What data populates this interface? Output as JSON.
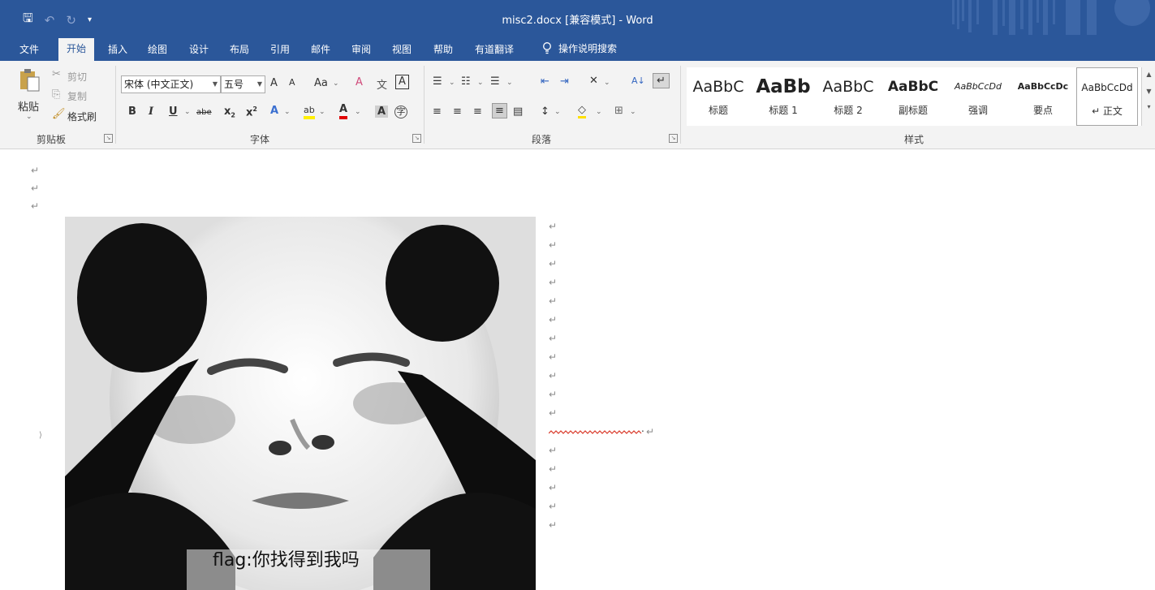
{
  "window": {
    "title": "misc2.docx [兼容模式] - Word"
  },
  "quick_access": {
    "save": "🖫",
    "undo": "↶",
    "redo": "↻",
    "customize": "▾"
  },
  "tabs": [
    {
      "label": "文件"
    },
    {
      "label": "开始"
    },
    {
      "label": "插入"
    },
    {
      "label": "绘图"
    },
    {
      "label": "设计"
    },
    {
      "label": "布局"
    },
    {
      "label": "引用"
    },
    {
      "label": "邮件"
    },
    {
      "label": "审阅"
    },
    {
      "label": "视图"
    },
    {
      "label": "帮助"
    },
    {
      "label": "有道翻译"
    }
  ],
  "tell_me": {
    "label": "操作说明搜索"
  },
  "clipboard": {
    "paste": "粘贴",
    "cut": "剪切",
    "copy": "复制",
    "format_painter": "格式刷",
    "group_label": "剪贴板"
  },
  "font": {
    "font_name": "宋体 (中文正文)",
    "font_size": "五号",
    "grow": "A",
    "shrink": "A",
    "change_case": "Aa",
    "clear": "A",
    "phonetic": "文",
    "border_char": "A",
    "bold": "B",
    "italic": "I",
    "underline": "U",
    "strike": "abe",
    "subscript": "x",
    "superscript": "x",
    "effects": "A",
    "highlight": "ab",
    "color": "A",
    "shading": "A",
    "enclose": "字",
    "group_label": "字体"
  },
  "paragraph": {
    "group_label": "段落",
    "sort": "A↓",
    "show_marks": "↵"
  },
  "styles": {
    "group_label": "样式",
    "items": [
      {
        "preview": "AaBbC",
        "name": "标题"
      },
      {
        "preview": "AaBb",
        "name": "标题 1"
      },
      {
        "preview": "AaBbC",
        "name": "标题 2"
      },
      {
        "preview": "AaBbC",
        "name": "副标题"
      },
      {
        "preview": "AaBbCcDd",
        "name": "强调"
      },
      {
        "preview": "AaBbCcDc",
        "name": "要点"
      },
      {
        "preview": "AaBbCcDd",
        "name": "↵ 正文"
      }
    ]
  },
  "document": {
    "para_mark": "↵",
    "image_caption": "flag:你找得到我吗",
    "hidden_dot": "."
  }
}
